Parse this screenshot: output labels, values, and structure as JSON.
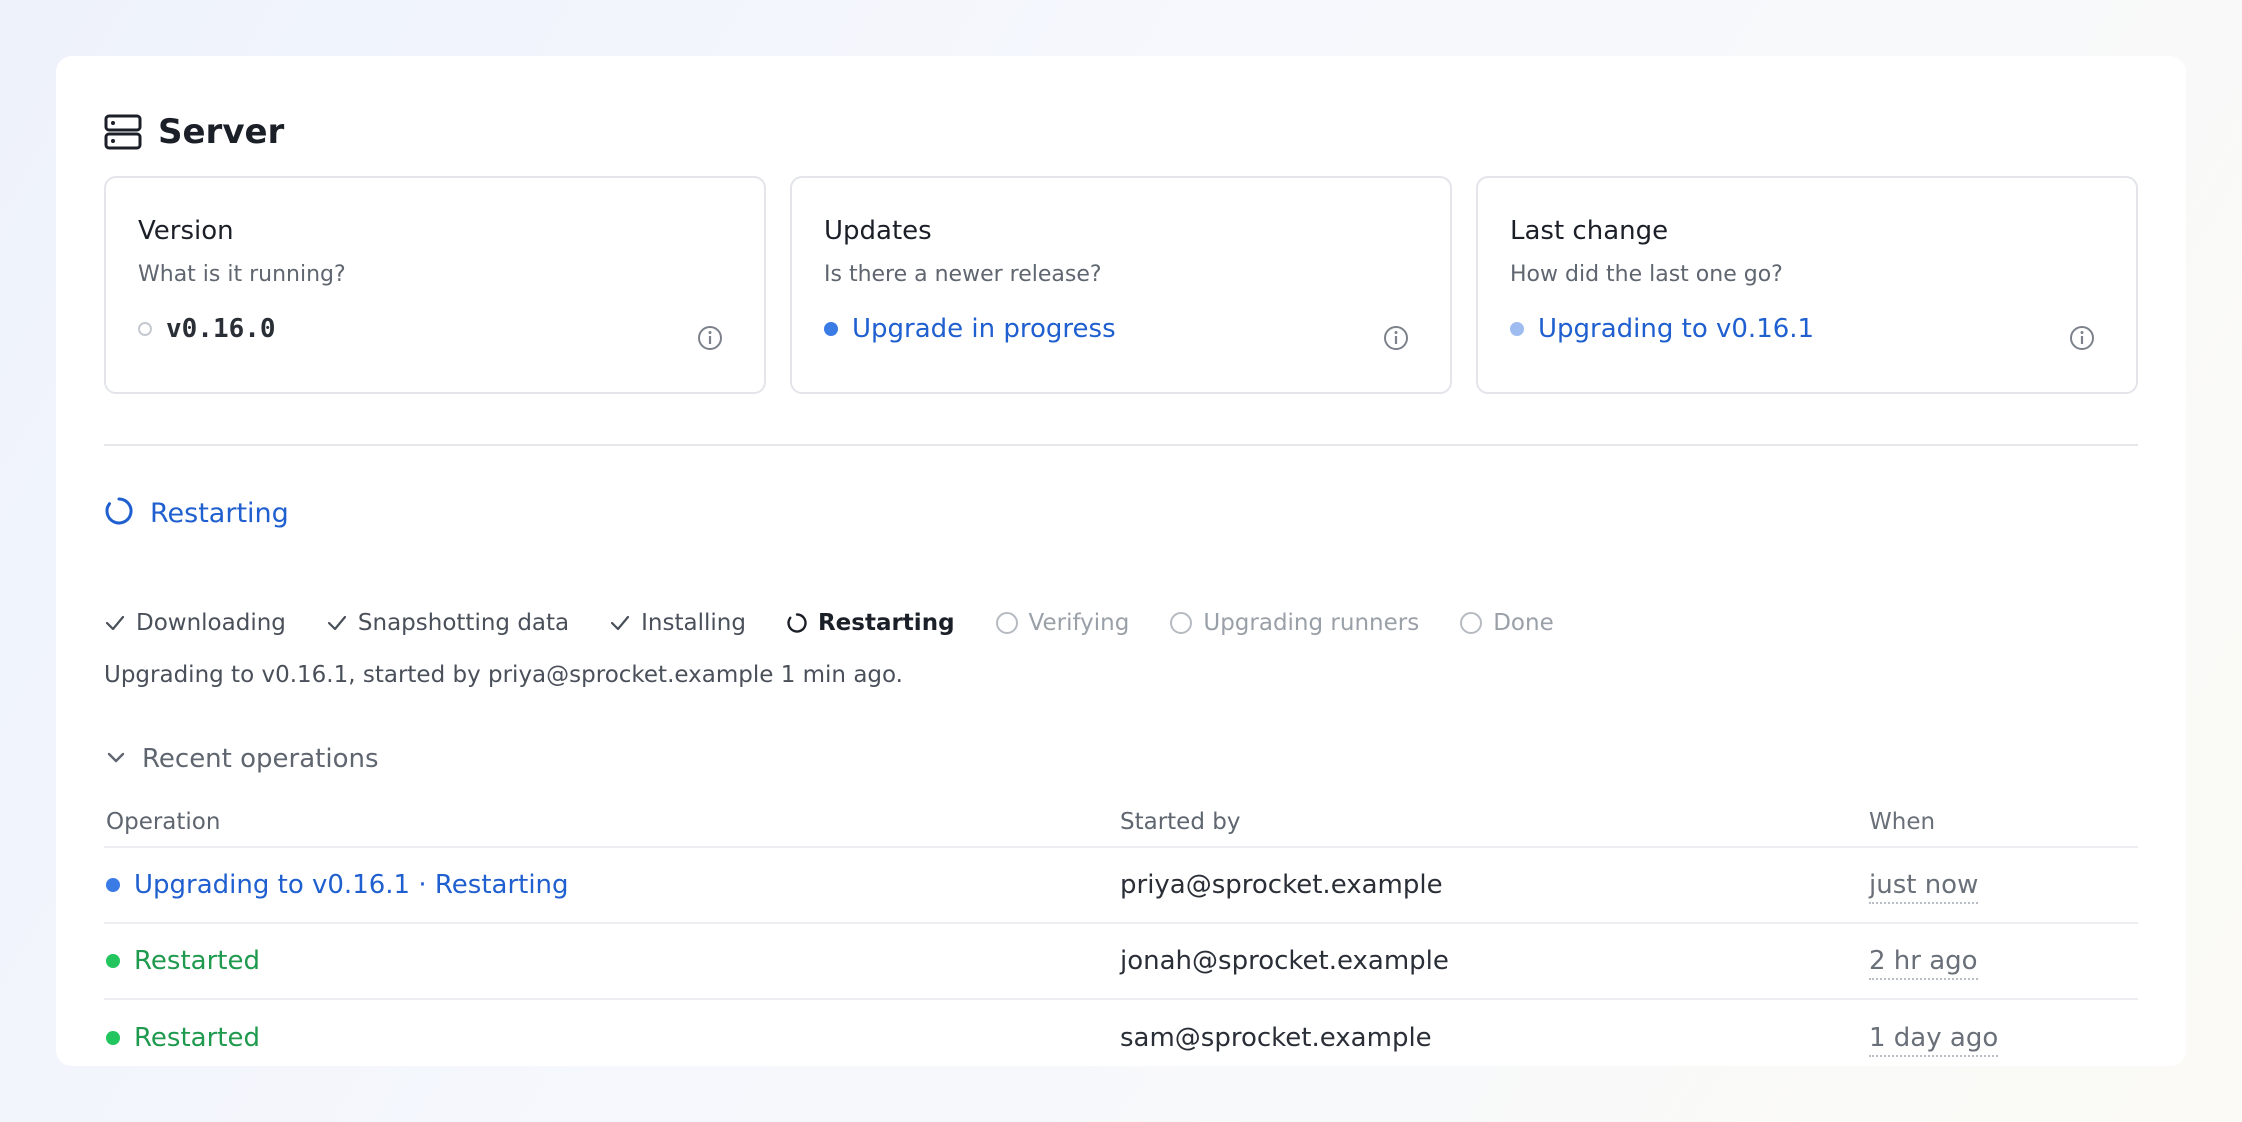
{
  "page": {
    "title": "Server"
  },
  "colors": {
    "accent": "#1f5fcf",
    "success": "#1f9a4e",
    "progress_dot": "#3b7be6",
    "light_dot": "#9ebcf0",
    "success_dot": "#22c55e"
  },
  "cards": [
    {
      "title": "Version",
      "subtitle": "What is it running?",
      "value": "v0.16.0",
      "status": "idle"
    },
    {
      "title": "Updates",
      "subtitle": "Is there a newer release?",
      "value": "Upgrade in progress",
      "status": "in-progress"
    },
    {
      "title": "Last change",
      "subtitle": "How did the last one go?",
      "value": "Upgrading to v0.16.1",
      "status": "pending"
    }
  ],
  "status": {
    "label": "Restarting"
  },
  "steps": [
    {
      "label": "Downloading",
      "state": "done"
    },
    {
      "label": "Snapshotting data",
      "state": "done"
    },
    {
      "label": "Installing",
      "state": "done"
    },
    {
      "label": "Restarting",
      "state": "active"
    },
    {
      "label": "Verifying",
      "state": "pending"
    },
    {
      "label": "Upgrading runners",
      "state": "pending"
    },
    {
      "label": "Done",
      "state": "pending"
    }
  ],
  "summary": "Upgrading to v0.16.1, started by priya@sprocket.example 1 min ago.",
  "recent": {
    "label": "Recent operations",
    "columns": [
      "Operation",
      "Started by",
      "When"
    ],
    "rows": [
      {
        "operation": "Upgrading to v0.16.1 · Restarting",
        "started_by": "priya@sprocket.example",
        "when": "just now",
        "status": "in-progress"
      },
      {
        "operation": "Restarted",
        "started_by": "jonah@sprocket.example",
        "when": "2 hr ago",
        "status": "success"
      },
      {
        "operation": "Restarted",
        "started_by": "sam@sprocket.example",
        "when": "1 day ago",
        "status": "success"
      }
    ]
  }
}
